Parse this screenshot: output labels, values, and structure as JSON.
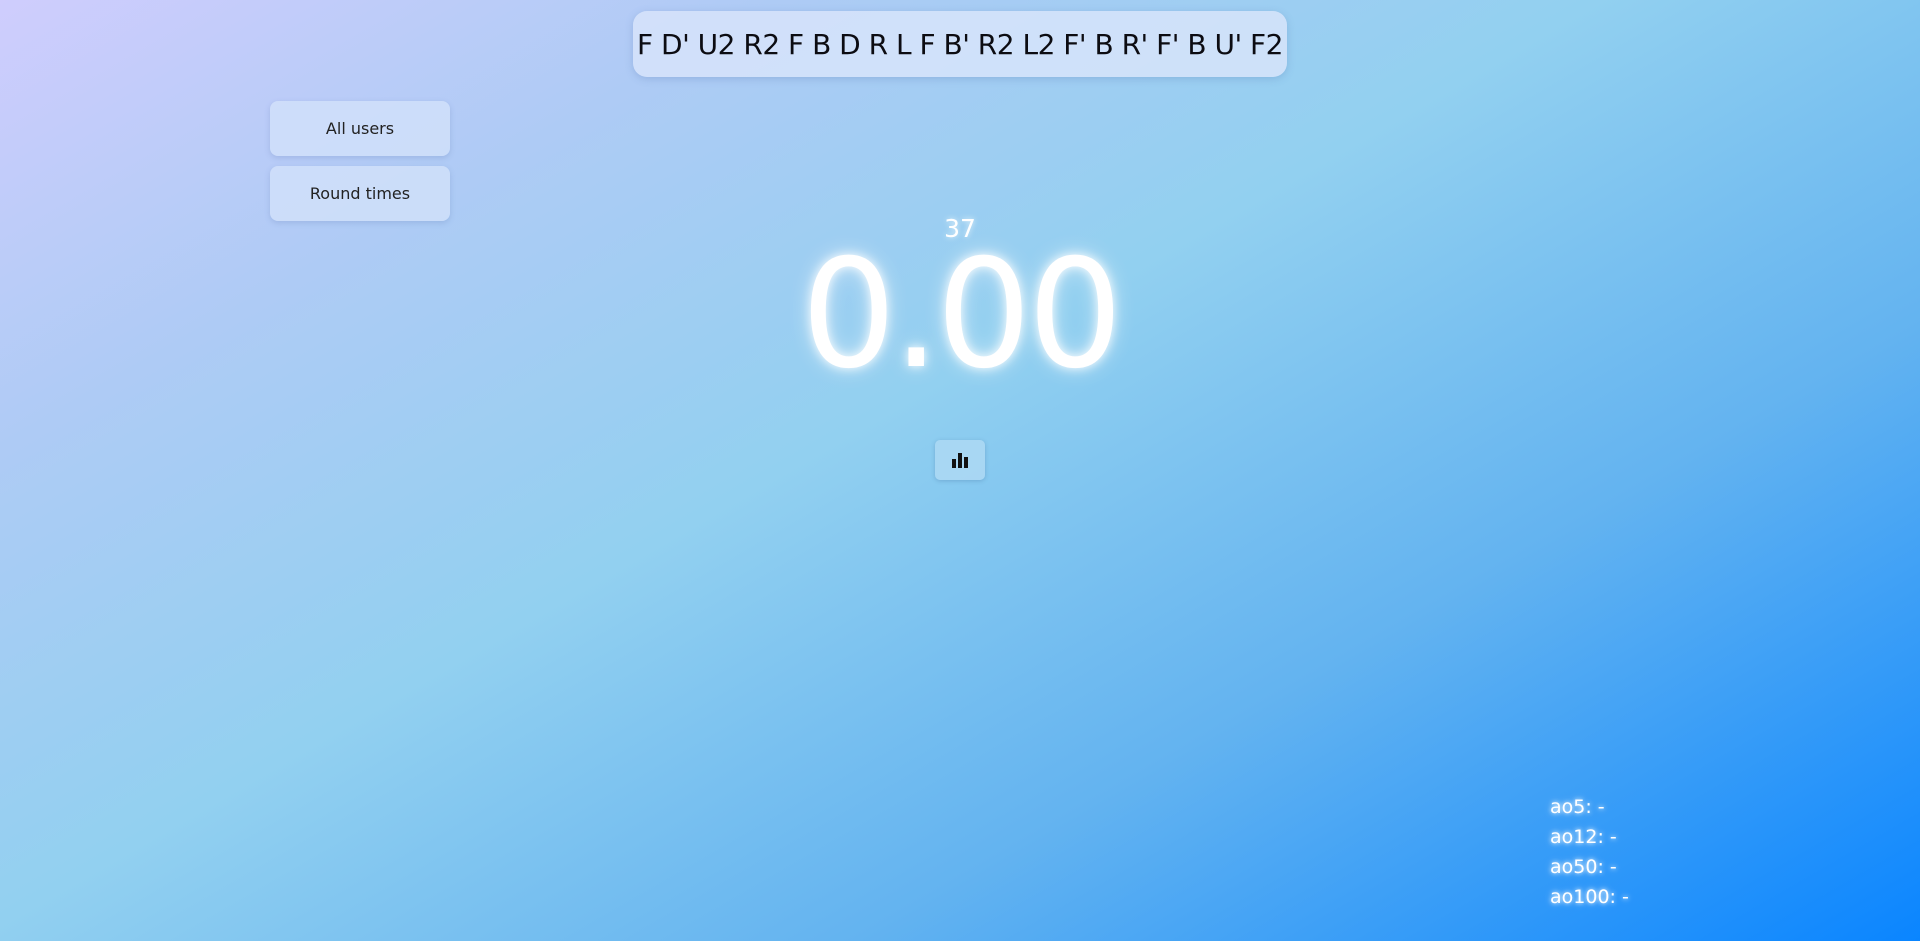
{
  "scramble": "F D' U2 R2 F B D R L F B' R2 L2 F' B R' F' B U' F2",
  "sidebar": {
    "all_users_label": "All users",
    "round_times_label": "Round times"
  },
  "timer": {
    "solve_count": "37",
    "time": "0.00"
  },
  "stats_button": {
    "icon": "bar-chart-icon"
  },
  "averages": [
    {
      "label": "ao5: -"
    },
    {
      "label": "ao12: -"
    },
    {
      "label": "ao50: -"
    },
    {
      "label": "ao100: -"
    }
  ],
  "colors": {
    "gradient_start": "#cfcdfd",
    "gradient_end": "#0a85ff",
    "timer_text": "#ffffff"
  }
}
